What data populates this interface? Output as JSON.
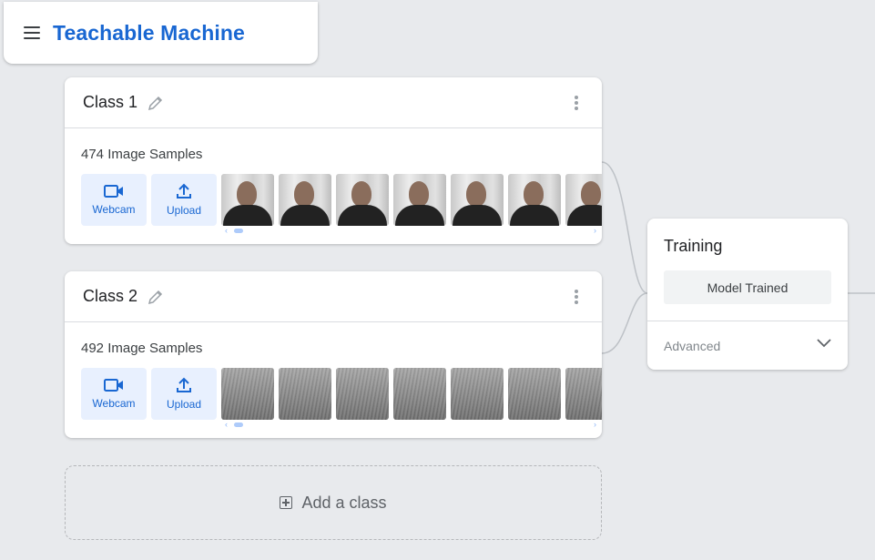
{
  "app": {
    "title": "Teachable Machine",
    "accent": "#1967d2"
  },
  "classes": [
    {
      "name": "Class 1",
      "samples_label": "474 Image Samples",
      "webcam_label": "Webcam",
      "upload_label": "Upload",
      "thumb_kind": "face"
    },
    {
      "name": "Class 2",
      "samples_label": "492 Image Samples",
      "webcam_label": "Webcam",
      "upload_label": "Upload",
      "thumb_kind": "wall"
    }
  ],
  "add_class": {
    "label": "Add a class"
  },
  "training": {
    "title": "Training",
    "status_label": "Model Trained",
    "advanced_label": "Advanced"
  }
}
